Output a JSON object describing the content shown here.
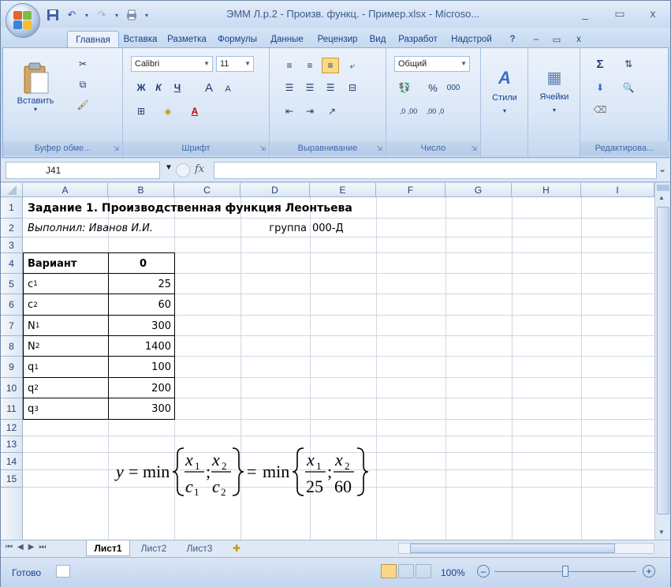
{
  "window": {
    "title": "ЭММ Л.р.2 - Произв. функц. - Пример.xlsx - Microso...",
    "controls": [
      "_",
      "▭",
      "x"
    ]
  },
  "tabs": [
    {
      "label": "Главная",
      "active": true
    },
    {
      "label": "Вставка"
    },
    {
      "label": "Разметка"
    },
    {
      "label": "Формулы"
    },
    {
      "label": "Данные"
    },
    {
      "label": "Рецензир"
    },
    {
      "label": "Вид"
    },
    {
      "label": "Разработ"
    },
    {
      "label": "Надстрой"
    }
  ],
  "ribbon": {
    "clipboard": {
      "label": "Буфер обме...",
      "paste": "Вставить"
    },
    "font": {
      "label": "Шрифт",
      "name": "Calibri",
      "size": "11",
      "bold": "Ж",
      "italic": "К",
      "underline": "Ч",
      "grow": "A",
      "shrink": "A",
      "fontcolor": "A"
    },
    "alignment": {
      "label": "Выравнивание"
    },
    "number": {
      "label": "Число",
      "format": "Общий",
      "percent": "%",
      "thousands": "000",
      "inc": ",0 ,00",
      "dec": ",00 ,0"
    },
    "styles": {
      "label": "Стили"
    },
    "cells": {
      "label": "Ячейки"
    },
    "editing": {
      "label": "Редактирова...",
      "sum": "Σ"
    }
  },
  "formula_bar": {
    "name_box": "J41",
    "fx": "fx",
    "content": ""
  },
  "columns": [
    "A",
    "B",
    "C",
    "D",
    "E",
    "F",
    "G",
    "H",
    "I"
  ],
  "rows": [
    "1",
    "2",
    "3",
    "4",
    "5",
    "6",
    "7",
    "8",
    "9",
    "10",
    "11",
    "12",
    "13",
    "14",
    "15"
  ],
  "sheet": {
    "title": "Задание 1. Производственная функция Леонтьева",
    "author": "Выполнил: Иванов И.И.",
    "group_label": "группа",
    "group_value": "000-Д",
    "table": [
      {
        "name": "Вариант",
        "sub": "",
        "value": "0"
      },
      {
        "name": "c",
        "sub": "1",
        "value": "25"
      },
      {
        "name": "c",
        "sub": "2",
        "value": "60"
      },
      {
        "name": "N",
        "sub": "1",
        "value": "300"
      },
      {
        "name": "N",
        "sub": "2",
        "value": "1400"
      },
      {
        "name": "q",
        "sub": "1",
        "value": "100"
      },
      {
        "name": "q",
        "sub": "2",
        "value": "200"
      },
      {
        "name": "q",
        "sub": "3",
        "value": "300"
      }
    ],
    "formula": {
      "y": "y",
      "eq": "=",
      "min": "min",
      "x1": "x",
      "x2": "x",
      "c1": "c",
      "c2": "c",
      "one": "1",
      "two": "2",
      "n25": "25",
      "n60": "60",
      "semi": ";"
    }
  },
  "sheet_tabs": [
    {
      "label": "Лист1",
      "active": true
    },
    {
      "label": "Лист2"
    },
    {
      "label": "Лист3"
    }
  ],
  "status": {
    "ready": "Готово",
    "zoom": "100%"
  }
}
